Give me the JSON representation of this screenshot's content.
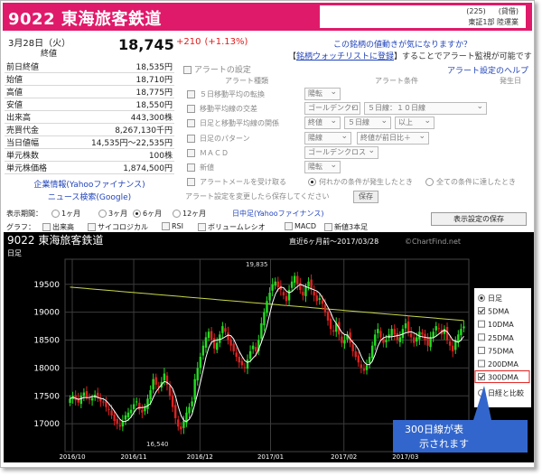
{
  "header": {
    "title": "9022 東海旅客鉄道",
    "code_num": "(225)",
    "code_tag": "(貸借)",
    "market": "東証1部",
    "sector": "陸運業"
  },
  "quote": {
    "date": "3月28日（火）",
    "close_label": "終値",
    "price": "18,745",
    "change": "+210",
    "change_pct": "(+1.13%)",
    "rows": [
      {
        "k": "前日終値",
        "v": "18,535円"
      },
      {
        "k": "始値",
        "v": "18,710円"
      },
      {
        "k": "高値",
        "v": "18,775円"
      },
      {
        "k": "安値",
        "v": "18,550円"
      },
      {
        "k": "出来高",
        "v": "443,300株"
      },
      {
        "k": "売買代金",
        "v": "8,267,130千円"
      },
      {
        "k": "当日値幅",
        "v": "14,535円～22,535円"
      },
      {
        "k": "単元株数",
        "v": "100株"
      },
      {
        "k": "単元株価格",
        "v": "1,874,500円"
      }
    ],
    "link_info": "企業情報(Yahooファイナンス)",
    "link_news": "ニュース検索(Google)"
  },
  "alert": {
    "promo1": "この銘柄の値動きが気になりますか？",
    "promo2_pre": "【",
    "promo2_link": "銘柄ウォッチリストに登録",
    "promo2_post": "】することでアラート監視が可能です",
    "help": "アラート設定のヘルプ",
    "head_label": "アラートの設定",
    "col_type": "アラート種類",
    "col_cond": "アラート条件",
    "col_day": "発生日",
    "rows": [
      {
        "label": "５日移動平均の転換",
        "s1": "陽転"
      },
      {
        "label": "移動平均線の交差",
        "s1": "ゴールデンクロス",
        "s2": "５日線：１０日線"
      },
      {
        "label": "日足と移動平均線の関係",
        "s1": "終値",
        "s2": "５日線",
        "s3": "以上"
      },
      {
        "label": "日足のパターン",
        "s1": "陽線",
        "s2": "終値が前日比＋"
      },
      {
        "label": "ＭＡＣＤ",
        "s1": "ゴールデンクロス"
      },
      {
        "label": "新値",
        "s1": "陽転"
      }
    ],
    "mail_label": "アラートメールを受け取る",
    "opt_any": "何れかの条件が発生したとき",
    "opt_all": "全ての条件に達したとき",
    "save_note": "アラート設定を変更したら保存してください",
    "save_btn": "保存"
  },
  "controls": {
    "period_label": "表示期間：",
    "periods": [
      "1ヶ月",
      "3ヶ月",
      "6ヶ月",
      "12ヶ月"
    ],
    "period_selected": 2,
    "daily_link": "日中足(Yahooファイナンス)",
    "graph_label": "グラフ：",
    "graphs": [
      "出来高",
      "サイコロジカル",
      "RSI",
      "ボリュームレシオ",
      "MACD",
      "新値3本足"
    ],
    "save_view": "表示設定の保存"
  },
  "chart_data": {
    "type": "candlestick",
    "title": "9022 東海旅客鉄道",
    "range_label": "直近6ヶ月前～2017/03/28",
    "credit": "©ChartFind.net",
    "ylabel": "日足",
    "ylim": [
      16500,
      19950
    ],
    "yticks": [
      17000,
      17500,
      18000,
      18500,
      19000,
      19500
    ],
    "xticks": [
      "2016/10",
      "2016/11",
      "2016/12",
      "2017/01",
      "2017/02",
      "2017/03"
    ],
    "high_label": "19,835",
    "low_label": "16,540",
    "closes": [
      17450,
      17500,
      17420,
      17380,
      17500,
      17560,
      17480,
      17430,
      17460,
      17520,
      17470,
      17400,
      17380,
      17300,
      17250,
      17150,
      17050,
      17000,
      16950,
      17050,
      17150,
      17200,
      17250,
      17350,
      17400,
      17250,
      17200,
      17300,
      17450,
      17600,
      17800,
      17700,
      17650,
      17750,
      17900,
      17700,
      17500,
      17300,
      17100,
      16950,
      16900,
      17050,
      17200,
      17300,
      17400,
      17800,
      18000,
      18200,
      18400,
      18550,
      18650,
      18500,
      18350,
      18450,
      18600,
      18750,
      18650,
      18500,
      18400,
      18300,
      18200,
      18100,
      18050,
      18000,
      18150,
      18300,
      18400,
      18300,
      18500,
      18800,
      19000,
      19200,
      19350,
      19500,
      19550,
      19450,
      19400,
      19300,
      19200,
      19400,
      19550,
      19650,
      19500,
      19400,
      19300,
      19450,
      19550,
      19400,
      19300,
      19200,
      19250,
      19150,
      19000,
      18850,
      18700,
      18650,
      18800,
      18600,
      18450,
      18500,
      18600,
      18450,
      18300,
      18200,
      18100,
      18000,
      17950,
      18050,
      18200,
      18400,
      18600,
      18700,
      18550,
      18450,
      18500,
      18600,
      18700,
      18600,
      18500,
      18550,
      18700,
      18800,
      18650,
      18550,
      18450,
      18550,
      18650,
      18600,
      18500,
      18400,
      18550,
      18650,
      18750,
      18700,
      18600,
      18700,
      18500,
      18400,
      18300,
      18500,
      18600,
      18700,
      18745
    ],
    "legend": [
      {
        "label": "日足",
        "type": "radio",
        "on": true
      },
      {
        "label": "5DMA",
        "type": "check",
        "on": true
      },
      {
        "label": "10DMA",
        "type": "check",
        "on": false
      },
      {
        "label": "25DMA",
        "type": "check",
        "on": false
      },
      {
        "label": "75DMA",
        "type": "check",
        "on": false
      },
      {
        "label": "200DMA",
        "type": "check",
        "on": false
      },
      {
        "label": "300DMA",
        "type": "check",
        "on": true
      },
      {
        "label": "日経と比較",
        "type": "radio",
        "on": false
      }
    ],
    "callout": "300日線が表示されます",
    "colors": {
      "up": "#22dd22",
      "down": "#dd2222",
      "ma5": "#ffffff",
      "ma300": "#c8d84a",
      "grid": "#3c3c3c",
      "callout_bg": "#3366cc"
    }
  }
}
